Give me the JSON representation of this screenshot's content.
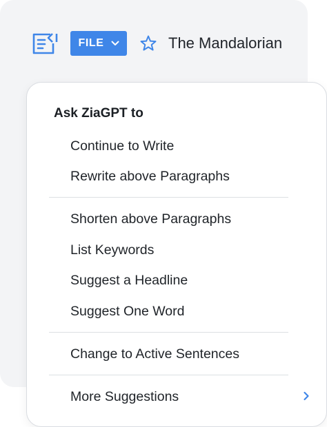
{
  "toolbar": {
    "doc_icon": "document-edit-icon",
    "file_label": "FILE",
    "file_chevron_icon": "chevron-down-icon",
    "star_icon": "star-outline-icon",
    "doc_title": "The Mandalorian"
  },
  "menu": {
    "heading": "Ask ZiaGPT to",
    "items": [
      "Continue to Write",
      "Rewrite above Paragraphs",
      "Shorten above Paragraphs",
      "List Keywords",
      "Suggest a Headline",
      "Suggest One Word",
      "Change to Active Sentences",
      "More Suggestions"
    ],
    "submenu_arrow_icon": "chevron-right-icon"
  },
  "colors": {
    "accent": "#3f86e8",
    "panel_bg": "#f3f4f6",
    "divider": "#dcdfe3"
  }
}
